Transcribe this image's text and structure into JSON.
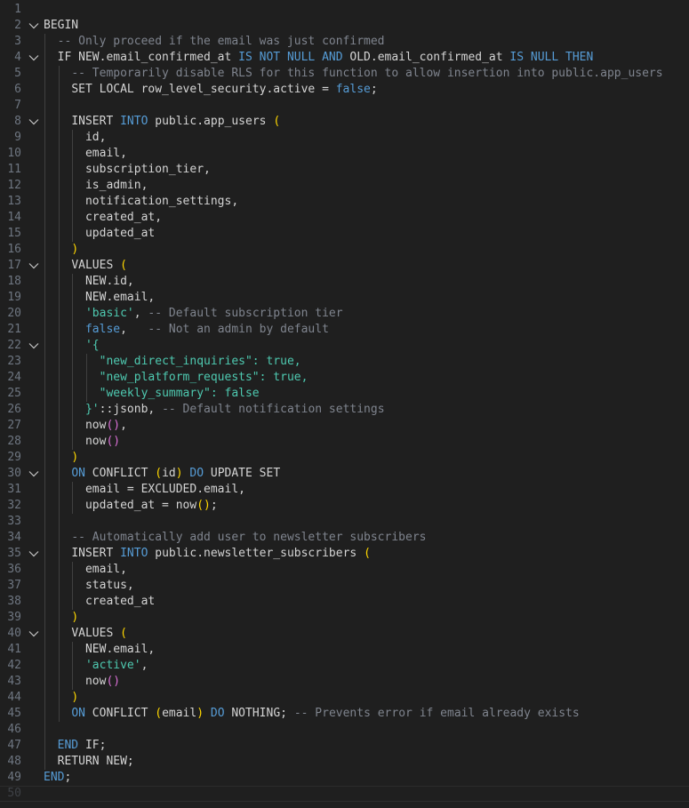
{
  "theme": {
    "background": "#1f1f1f",
    "line_number": "#6e7681",
    "indent_guide": "#404040",
    "keyword": "#569cd6",
    "comment": "#7f848e",
    "string": "#4ec9b0",
    "bracket_level_1": "#ffd700",
    "bracket_level_2": "#da70d6",
    "text": "#d4d4d4"
  },
  "editor": {
    "language": "sql",
    "current_line": 50,
    "lines": [
      {
        "n": "1",
        "indent": 0,
        "fold": false,
        "tokens": []
      },
      {
        "n": "2",
        "indent": 0,
        "fold": true,
        "tokens": [
          [
            "BEGIN",
            "plain"
          ]
        ]
      },
      {
        "n": "3",
        "indent": 1,
        "fold": false,
        "tokens": [
          [
            "-- Only proceed if the email was just confirmed",
            "cmtgray"
          ]
        ]
      },
      {
        "n": "4",
        "indent": 1,
        "fold": true,
        "tokens": [
          [
            "IF NEW.email_confirmed_at ",
            "plain"
          ],
          [
            "IS NOT NULL",
            "kw"
          ],
          [
            " ",
            "plain"
          ],
          [
            "AND",
            "kw"
          ],
          [
            " OLD.email_confirmed_at ",
            "plain"
          ],
          [
            "IS NULL",
            "kw"
          ],
          [
            " ",
            "plain"
          ],
          [
            "THEN",
            "kw"
          ]
        ]
      },
      {
        "n": "5",
        "indent": 2,
        "fold": false,
        "tokens": [
          [
            "-- Temporarily disable RLS for this function to allow insertion into public.app_users",
            "cmtgray"
          ]
        ]
      },
      {
        "n": "6",
        "indent": 2,
        "fold": false,
        "tokens": [
          [
            "SET LOCAL row_level_security.active = ",
            "plain"
          ],
          [
            "false",
            "kw"
          ],
          [
            ";",
            "plain"
          ]
        ]
      },
      {
        "n": "7",
        "indent": 2,
        "fold": false,
        "tokens": []
      },
      {
        "n": "8",
        "indent": 2,
        "fold": true,
        "tokens": [
          [
            "INSERT ",
            "plain"
          ],
          [
            "INTO",
            "kw"
          ],
          [
            " public.app_users ",
            "plain"
          ],
          [
            "(",
            "br1"
          ]
        ]
      },
      {
        "n": "9",
        "indent": 3,
        "fold": false,
        "tokens": [
          [
            "id,",
            "plain"
          ]
        ]
      },
      {
        "n": "10",
        "indent": 3,
        "fold": false,
        "tokens": [
          [
            "email,",
            "plain"
          ]
        ]
      },
      {
        "n": "11",
        "indent": 3,
        "fold": false,
        "tokens": [
          [
            "subscription_tier,",
            "plain"
          ]
        ]
      },
      {
        "n": "12",
        "indent": 3,
        "fold": false,
        "tokens": [
          [
            "is_admin,",
            "plain"
          ]
        ]
      },
      {
        "n": "13",
        "indent": 3,
        "fold": false,
        "tokens": [
          [
            "notification_settings,",
            "plain"
          ]
        ]
      },
      {
        "n": "14",
        "indent": 3,
        "fold": false,
        "tokens": [
          [
            "created_at,",
            "plain"
          ]
        ]
      },
      {
        "n": "15",
        "indent": 3,
        "fold": false,
        "tokens": [
          [
            "updated_at",
            "plain"
          ]
        ]
      },
      {
        "n": "16",
        "indent": 2,
        "fold": false,
        "tokens": [
          [
            ")",
            "br1"
          ]
        ]
      },
      {
        "n": "17",
        "indent": 2,
        "fold": true,
        "tokens": [
          [
            "VALUES ",
            "plain"
          ],
          [
            "(",
            "br1"
          ]
        ]
      },
      {
        "n": "18",
        "indent": 3,
        "fold": false,
        "tokens": [
          [
            "NEW.id,",
            "plain"
          ]
        ]
      },
      {
        "n": "19",
        "indent": 3,
        "fold": false,
        "tokens": [
          [
            "NEW.email,",
            "plain"
          ]
        ]
      },
      {
        "n": "20",
        "indent": 3,
        "fold": false,
        "tokens": [
          [
            "'basic'",
            "str"
          ],
          [
            ", ",
            "plain"
          ],
          [
            "-- Default subscription tier",
            "cmtgray"
          ]
        ]
      },
      {
        "n": "21",
        "indent": 3,
        "fold": false,
        "tokens": [
          [
            "false",
            "kw"
          ],
          [
            ",   ",
            "plain"
          ],
          [
            "-- Not an admin by default",
            "cmtgray"
          ]
        ]
      },
      {
        "n": "22",
        "indent": 3,
        "fold": true,
        "tokens": [
          [
            "'{",
            "str"
          ]
        ]
      },
      {
        "n": "23",
        "indent": 4,
        "fold": false,
        "tokens": [
          [
            "\"new_direct_inquiries\": true,",
            "str"
          ]
        ]
      },
      {
        "n": "24",
        "indent": 4,
        "fold": false,
        "tokens": [
          [
            "\"new_platform_requests\": true,",
            "str"
          ]
        ]
      },
      {
        "n": "25",
        "indent": 4,
        "fold": false,
        "tokens": [
          [
            "\"weekly_summary\": false",
            "str"
          ]
        ]
      },
      {
        "n": "26",
        "indent": 3,
        "fold": false,
        "tokens": [
          [
            "}'",
            "str"
          ],
          [
            "::jsonb, ",
            "plain"
          ],
          [
            "-- Default notification settings",
            "cmtgray"
          ]
        ]
      },
      {
        "n": "27",
        "indent": 3,
        "fold": false,
        "tokens": [
          [
            "now",
            "plain"
          ],
          [
            "()",
            "br2"
          ],
          [
            ",",
            "plain"
          ]
        ]
      },
      {
        "n": "28",
        "indent": 3,
        "fold": false,
        "tokens": [
          [
            "now",
            "plain"
          ],
          [
            "()",
            "br2"
          ]
        ]
      },
      {
        "n": "29",
        "indent": 2,
        "fold": false,
        "tokens": [
          [
            ")",
            "br1"
          ]
        ]
      },
      {
        "n": "30",
        "indent": 2,
        "fold": true,
        "tokens": [
          [
            "ON",
            "kw"
          ],
          [
            " CONFLICT ",
            "plain"
          ],
          [
            "(",
            "br1"
          ],
          [
            "id",
            "plain"
          ],
          [
            ")",
            "br1"
          ],
          [
            " ",
            "plain"
          ],
          [
            "DO",
            "kw"
          ],
          [
            " UPDATE SET",
            "plain"
          ]
        ]
      },
      {
        "n": "31",
        "indent": 3,
        "fold": false,
        "tokens": [
          [
            "email = EXCLUDED.email,",
            "plain"
          ]
        ]
      },
      {
        "n": "32",
        "indent": 3,
        "fold": false,
        "tokens": [
          [
            "updated_at = now",
            "plain"
          ],
          [
            "()",
            "br1"
          ],
          [
            ";",
            "plain"
          ]
        ]
      },
      {
        "n": "33",
        "indent": 3,
        "fold": false,
        "tokens": []
      },
      {
        "n": "34",
        "indent": 2,
        "fold": false,
        "tokens": [
          [
            "-- Automatically add user to newsletter subscribers",
            "cmtgray"
          ]
        ]
      },
      {
        "n": "35",
        "indent": 2,
        "fold": true,
        "tokens": [
          [
            "INSERT ",
            "plain"
          ],
          [
            "INTO",
            "kw"
          ],
          [
            " public.newsletter_subscribers ",
            "plain"
          ],
          [
            "(",
            "br1"
          ]
        ]
      },
      {
        "n": "36",
        "indent": 3,
        "fold": false,
        "tokens": [
          [
            "email,",
            "plain"
          ]
        ]
      },
      {
        "n": "37",
        "indent": 3,
        "fold": false,
        "tokens": [
          [
            "status,",
            "plain"
          ]
        ]
      },
      {
        "n": "38",
        "indent": 3,
        "fold": false,
        "tokens": [
          [
            "created_at",
            "plain"
          ]
        ]
      },
      {
        "n": "39",
        "indent": 2,
        "fold": false,
        "tokens": [
          [
            ")",
            "br1"
          ]
        ]
      },
      {
        "n": "40",
        "indent": 2,
        "fold": true,
        "tokens": [
          [
            "VALUES ",
            "plain"
          ],
          [
            "(",
            "br1"
          ]
        ]
      },
      {
        "n": "41",
        "indent": 3,
        "fold": false,
        "tokens": [
          [
            "NEW.email,",
            "plain"
          ]
        ]
      },
      {
        "n": "42",
        "indent": 3,
        "fold": false,
        "tokens": [
          [
            "'active'",
            "str"
          ],
          [
            ",",
            "plain"
          ]
        ]
      },
      {
        "n": "43",
        "indent": 3,
        "fold": false,
        "tokens": [
          [
            "now",
            "plain"
          ],
          [
            "()",
            "br2"
          ]
        ]
      },
      {
        "n": "44",
        "indent": 2,
        "fold": false,
        "tokens": [
          [
            ")",
            "br1"
          ]
        ]
      },
      {
        "n": "45",
        "indent": 2,
        "fold": false,
        "tokens": [
          [
            "ON",
            "kw"
          ],
          [
            " CONFLICT ",
            "plain"
          ],
          [
            "(",
            "br1"
          ],
          [
            "email",
            "plain"
          ],
          [
            ")",
            "br1"
          ],
          [
            " ",
            "plain"
          ],
          [
            "DO",
            "kw"
          ],
          [
            " NOTHING; ",
            "plain"
          ],
          [
            "-- Prevents error if email already exists",
            "cmtgray"
          ]
        ]
      },
      {
        "n": "46",
        "indent": 2,
        "fold": false,
        "tokens": []
      },
      {
        "n": "47",
        "indent": 1,
        "fold": false,
        "tokens": [
          [
            "END",
            "kw"
          ],
          [
            " IF;",
            "plain"
          ]
        ]
      },
      {
        "n": "48",
        "indent": 1,
        "fold": false,
        "tokens": [
          [
            "RETURN NEW;",
            "plain"
          ]
        ]
      },
      {
        "n": "49",
        "indent": 0,
        "fold": false,
        "tokens": [
          [
            "END",
            "kw"
          ],
          [
            ";",
            "plain"
          ]
        ]
      },
      {
        "n": "50",
        "indent": 0,
        "fold": false,
        "tokens": []
      }
    ]
  }
}
